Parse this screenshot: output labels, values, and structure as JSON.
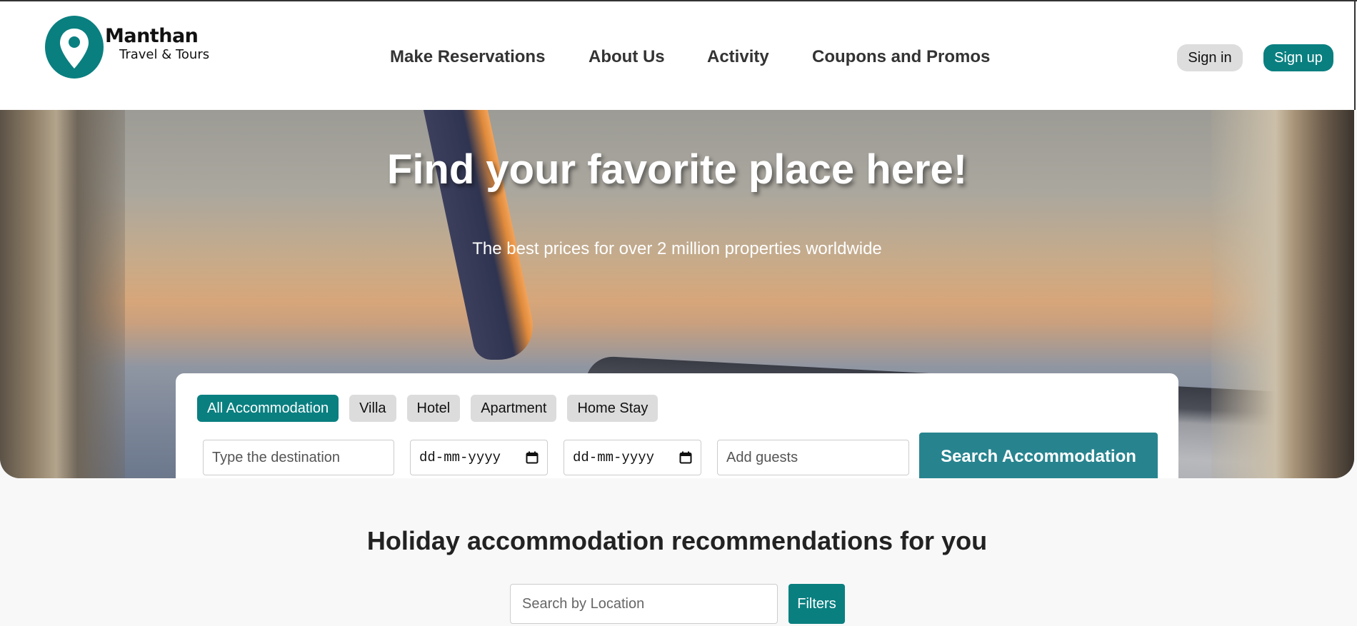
{
  "brand": {
    "name": "Manthan",
    "tagline": "Travel & Tours"
  },
  "nav": {
    "items": [
      {
        "label": "Make Reservations"
      },
      {
        "label": "About Us"
      },
      {
        "label": "Activity"
      },
      {
        "label": "Coupons and Promos"
      }
    ]
  },
  "auth": {
    "signin_label": "Sign in",
    "signup_label": "Sign up"
  },
  "hero": {
    "title": "Find your favorite place here!",
    "subtitle": "The best prices for over 2 million properties worldwide"
  },
  "search": {
    "categories": [
      {
        "label": "All Accommodation",
        "active": true
      },
      {
        "label": "Villa",
        "active": false
      },
      {
        "label": "Hotel",
        "active": false
      },
      {
        "label": "Apartment",
        "active": false
      },
      {
        "label": "Home Stay",
        "active": false
      }
    ],
    "destination_placeholder": "Type the destination",
    "checkin_value": "dd-mm-yyyy",
    "checkout_value": "dd-mm-yyyy",
    "guests_placeholder": "Add guests",
    "button_label": "Search Accommodation"
  },
  "recommendations": {
    "title": "Holiday accommodation recommendations for you",
    "location_placeholder": "Search by Location",
    "filters_label": "Filters"
  },
  "colors": {
    "brand_teal": "#0a7f80",
    "search_button": "#27848f",
    "chip_inactive": "#dcdcdc",
    "signin_bg": "#dddddd"
  },
  "icons": {
    "logo": "map-pin-icon",
    "date": "calendar-icon"
  }
}
